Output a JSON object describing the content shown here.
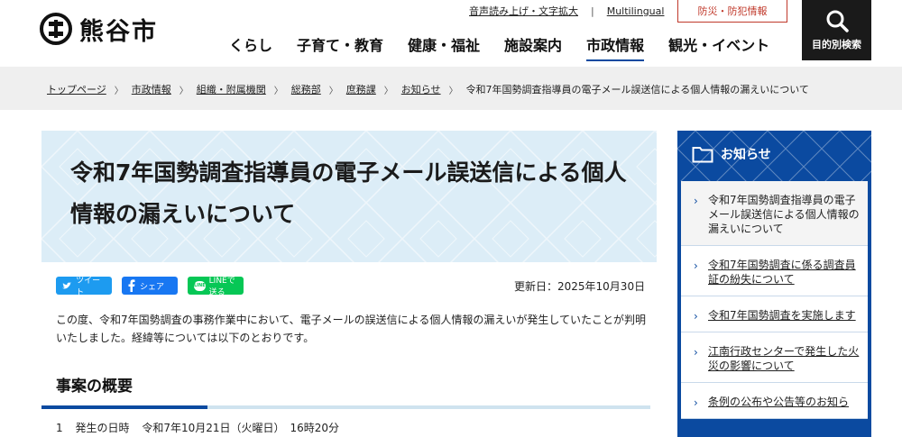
{
  "header": {
    "logo_text": "熊谷市",
    "util_links": [
      "音声読み上げ・文字拡大",
      "Multilingual"
    ],
    "util_separator": "|",
    "disaster_button": "防災・防犯情報",
    "nav": [
      "くらし",
      "子育て・教育",
      "健康・福祉",
      "施設案内",
      "市政情報",
      "観光・イベント"
    ],
    "nav_active": "市政情報",
    "search_label": "目的別検索"
  },
  "breadcrumb": {
    "items": [
      "トップページ",
      "市政情報",
      "組織・附属機関",
      "総務部",
      "庶務課",
      "お知らせ"
    ],
    "separator": "〉",
    "current": "令和7年国勢調査指導員の電子メール誤送信による個人情報の漏えいについて"
  },
  "article": {
    "title": "令和7年国勢調査指導員の電子メール誤送信による個人情報の漏えいについて",
    "share": {
      "twitter": "ツイート",
      "facebook": "シェア",
      "line": "LINEで送る",
      "line_icon_text": "LINE"
    },
    "updated": "更新日：2025年10月30日",
    "intro": "この度、令和7年国勢調査の事務作業中において、電子メールの誤送信による個人情報の漏えいが発生していたことが判明いたしました。経緯等については以下のとおりです。",
    "section_heading": "事案の概要",
    "item_1": {
      "number": "1",
      "label": "発生の日時",
      "value": "令和7年10月21日（火曜日）　16時20分"
    }
  },
  "sidebar": {
    "heading": "お知らせ",
    "items": [
      "令和7年国勢調査指導員の電子メール誤送信による個人情報の漏えいについて",
      "令和7年国勢調査に係る調査員証の紛失について",
      "令和7年国勢調査を実施します",
      "江南行政センターで発生した火災の影響について",
      "条例の公布や公告等のお知ら"
    ]
  },
  "colors": {
    "brand_blue": "#0b4aa0",
    "title_bg": "#dcedf7",
    "disaster_red": "#c0392b",
    "twitter": "#1d9bf0",
    "facebook": "#1877f2",
    "line": "#06c755"
  },
  "icons": {
    "logo": "city-emblem-icon",
    "search": "search-icon",
    "sidebar_heading": "folder-icon",
    "list_marker": "chevron-right-icon",
    "breadcrumb_separator": "chevron-right-icon"
  }
}
